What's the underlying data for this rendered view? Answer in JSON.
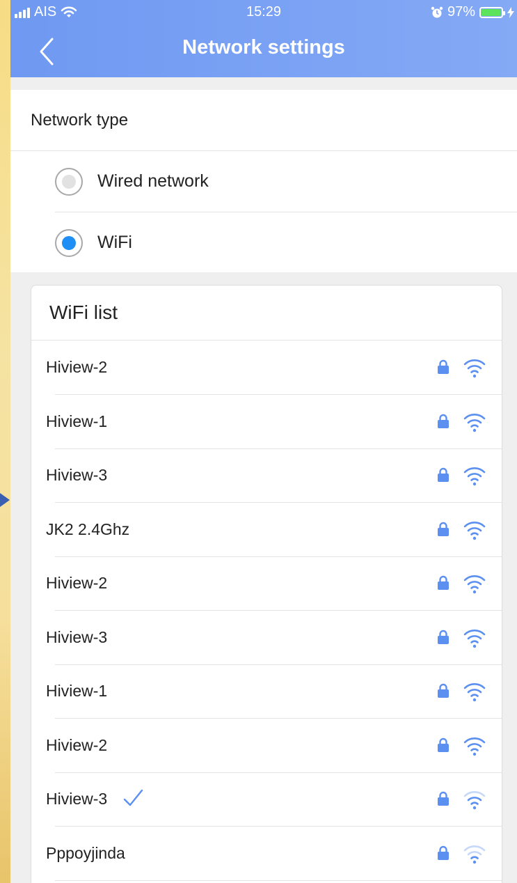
{
  "status_bar": {
    "carrier": "AIS",
    "time": "15:29",
    "battery": "97%",
    "battery_level": 0.97
  },
  "header": {
    "title": "Network settings",
    "back_icon": "chevron-left-icon"
  },
  "network_type": {
    "title": "Network type",
    "options": [
      {
        "label": "Wired network",
        "selected": false
      },
      {
        "label": "WiFi",
        "selected": true
      }
    ]
  },
  "wifi_list": {
    "title": "WiFi list",
    "items": [
      {
        "name": "Hiview-2",
        "locked": true,
        "connected": false,
        "signal": "full"
      },
      {
        "name": "Hiview-1",
        "locked": true,
        "connected": false,
        "signal": "full"
      },
      {
        "name": "Hiview-3",
        "locked": true,
        "connected": false,
        "signal": "full"
      },
      {
        "name": "JK2 2.4Ghz",
        "locked": true,
        "connected": false,
        "signal": "full"
      },
      {
        "name": "Hiview-2",
        "locked": true,
        "connected": false,
        "signal": "full"
      },
      {
        "name": "Hiview-3",
        "locked": true,
        "connected": false,
        "signal": "full"
      },
      {
        "name": "Hiview-1",
        "locked": true,
        "connected": false,
        "signal": "full"
      },
      {
        "name": "Hiview-2",
        "locked": true,
        "connected": false,
        "signal": "full"
      },
      {
        "name": "Hiview-3",
        "locked": true,
        "connected": true,
        "signal": "medium"
      },
      {
        "name": "Pppoyjinda",
        "locked": true,
        "connected": false,
        "signal": "weak"
      }
    ]
  },
  "colors": {
    "accent": "#5b8ff0",
    "header_start": "#6f99f2",
    "header_end": "#84a9f5",
    "radio_selected": "#1f8ef5",
    "radio_unselected": "#e2e2e2"
  }
}
